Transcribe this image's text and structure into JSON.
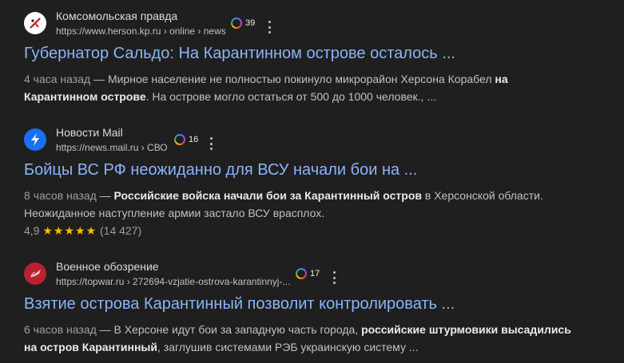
{
  "results": [
    {
      "site_name": "Комсомольская правда",
      "url": "https://www.herson.kp.ru › online › news",
      "badge_count": "39",
      "title": "Губернатор Сальдо: На Карантинном острове осталось ...",
      "snippet": {
        "time": "4 часа назад",
        "dash": " — ",
        "text1": "Мирное население не полностью покинуло микрорайон Херсона Корабел ",
        "bold1": "на Карантинном острове",
        "text2": ". На острове могло остаться от 500 до 1000 человек., ..."
      }
    },
    {
      "site_name": "Новости Mail",
      "url": "https://news.mail.ru › СВО",
      "badge_count": "16",
      "title": "Бойцы ВС РФ неожиданно для ВСУ начали бои на ...",
      "snippet": {
        "time": "8 часов назад",
        "dash": " — ",
        "bold1": "Российские войска начали бои за Карантинный остров",
        "text1": " в Херсонской области. Неожиданное наступление армии застало ВСУ врасплох."
      },
      "rating": {
        "value": "4,9",
        "stars": "★★★★★",
        "count": "(14 427)"
      }
    },
    {
      "site_name": "Военное обозрение",
      "url": "https://topwar.ru › 272694-vzjatie-ostrova-karantinnyj-...",
      "badge_count": "17",
      "title": "Взятие острова Карантинный позволит контролировать ...",
      "snippet": {
        "time": "6 часов назад",
        "dash": " — ",
        "text1": "В Херсоне идут бои за западную часть города, ",
        "bold1": "российские штурмовики высадились на остров Карантинный",
        "text2": ", заглушив системами РЭБ украинскую систему ..."
      }
    }
  ]
}
